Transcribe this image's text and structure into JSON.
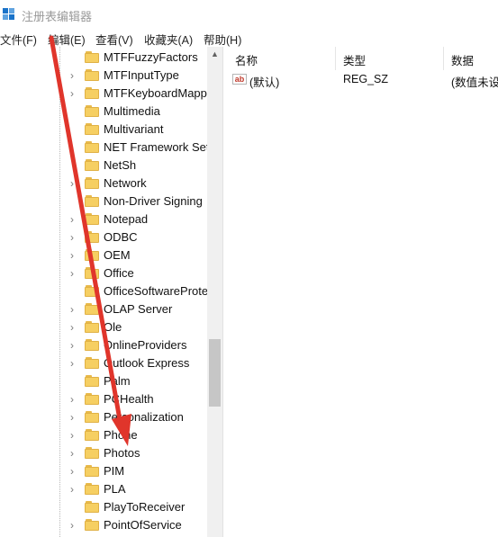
{
  "window": {
    "title": "注册表编辑器"
  },
  "menu": [
    "文件(F)",
    "编辑(E)",
    "查看(V)",
    "收藏夹(A)",
    "帮助(H)"
  ],
  "tree": {
    "items": [
      {
        "label": "MTFFuzzyFactors",
        "expandable": false
      },
      {
        "label": "MTFInputType",
        "expandable": true
      },
      {
        "label": "MTFKeyboardMappings",
        "expandable": true
      },
      {
        "label": "Multimedia",
        "expandable": false
      },
      {
        "label": "Multivariant",
        "expandable": false
      },
      {
        "label": "NET Framework Setup",
        "expandable": true
      },
      {
        "label": "NetSh",
        "expandable": false
      },
      {
        "label": "Network",
        "expandable": true
      },
      {
        "label": "Non-Driver Signing",
        "expandable": false
      },
      {
        "label": "Notepad",
        "expandable": true
      },
      {
        "label": "ODBC",
        "expandable": true
      },
      {
        "label": "OEM",
        "expandable": true
      },
      {
        "label": "Office",
        "expandable": true
      },
      {
        "label": "OfficeSoftwareProtectionPlatform",
        "expandable": false
      },
      {
        "label": "OLAP Server",
        "expandable": true
      },
      {
        "label": "Ole",
        "expandable": true
      },
      {
        "label": "OnlineProviders",
        "expandable": true
      },
      {
        "label": "Outlook Express",
        "expandable": true
      },
      {
        "label": "Palm",
        "expandable": false
      },
      {
        "label": "PCHealth",
        "expandable": true
      },
      {
        "label": "Personalization",
        "expandable": true
      },
      {
        "label": "Phone",
        "expandable": true
      },
      {
        "label": "Photos",
        "expandable": true
      },
      {
        "label": "PIM",
        "expandable": true
      },
      {
        "label": "PLA",
        "expandable": true
      },
      {
        "label": "PlayToReceiver",
        "expandable": false
      },
      {
        "label": "PointOfService",
        "expandable": true
      }
    ]
  },
  "values": {
    "columns": {
      "name": "名称",
      "type": "类型",
      "data": "数据"
    },
    "rows": [
      {
        "name": "(默认)",
        "type": "REG_SZ",
        "data": "(数值未设置)"
      }
    ]
  },
  "colors": {
    "annotation_arrow": "#e0352b",
    "folder": "#f6cf62"
  },
  "icons": {
    "app": "regedit-icon",
    "value": "string-value-icon",
    "expander": "chevron-right-icon",
    "folder": "folder-icon"
  }
}
